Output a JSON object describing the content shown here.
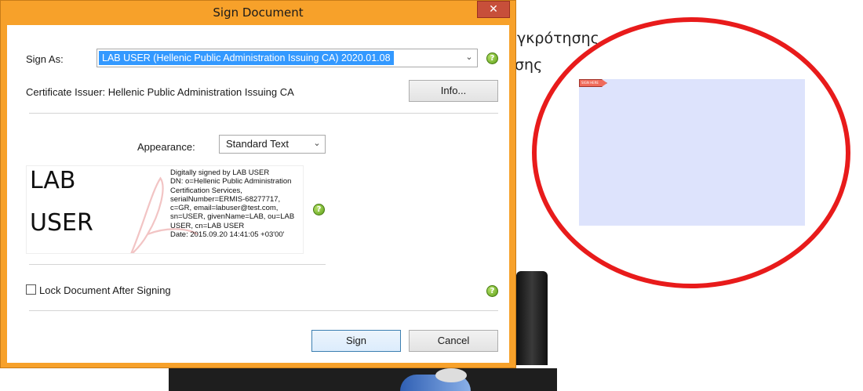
{
  "background": {
    "line1": "υγκρότησης",
    "line2": "σης",
    "signature_tag": "SIGN HERE"
  },
  "dialog": {
    "title": "Sign Document",
    "close_glyph": "✕",
    "sign_as_label": "Sign As:",
    "sign_as_value": "LAB USER (Hellenic Public Administration Issuing CA) 2020.01.08",
    "certificate_issuer": "Certificate Issuer: Hellenic Public Administration Issuing CA",
    "info_button": "Info...",
    "appearance_label": "Appearance:",
    "appearance_value": "Standard Text",
    "help_glyph": "?",
    "preview": {
      "name_line1": "LAB",
      "name_line2": "USER",
      "details": [
        "Digitally signed by LAB USER",
        "DN: o=Hellenic Public Administration",
        "Certification Services,",
        "serialNumber=ERMIS-68277717,",
        "c=GR, email=labuser@test.com,",
        "sn=USER, givenName=LAB, ou=LAB",
        "USER, cn=LAB USER",
        "Date: 2015.09.20 14:41:05 +03'00'"
      ]
    },
    "lock_label": "Lock Document After Signing",
    "lock_checked": false,
    "sign_button": "Sign",
    "cancel_button": "Cancel"
  },
  "colors": {
    "title_bar": "#f7a12a",
    "close_button": "#c74f3a",
    "selection": "#3399ff",
    "signature_field": "#dde3fc",
    "annotation_ellipse": "#e81b1b"
  }
}
